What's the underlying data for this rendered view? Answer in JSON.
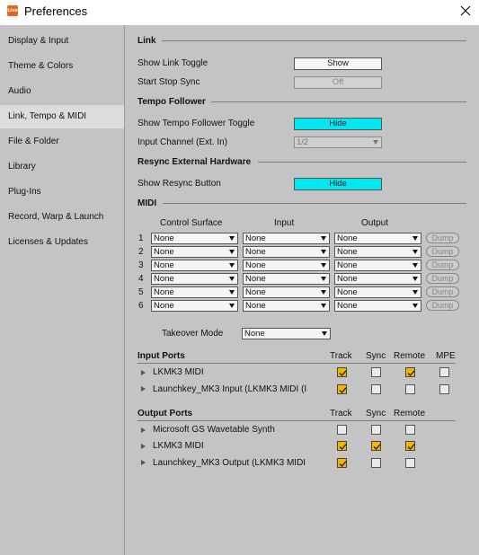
{
  "window": {
    "title": "Preferences",
    "app_icon_text": "Live"
  },
  "sidebar": {
    "items": [
      {
        "label": "Display & Input"
      },
      {
        "label": "Theme & Colors"
      },
      {
        "label": "Audio"
      },
      {
        "label": "Link, Tempo & MIDI",
        "selected": true
      },
      {
        "label": "File & Folder"
      },
      {
        "label": "Library"
      },
      {
        "label": "Plug-Ins"
      },
      {
        "label": "Record, Warp & Launch"
      },
      {
        "label": "Licenses & Updates"
      }
    ]
  },
  "link": {
    "header": "Link",
    "show_link_toggle": {
      "label": "Show Link Toggle",
      "value": "Show"
    },
    "start_stop_sync": {
      "label": "Start Stop Sync",
      "value": "Off"
    }
  },
  "tempo": {
    "header": "Tempo Follower",
    "show_toggle": {
      "label": "Show Tempo Follower Toggle",
      "value": "Hide"
    },
    "input_channel": {
      "label": "Input Channel (Ext. In)",
      "value": "1/2"
    }
  },
  "resync": {
    "header": "Resync External Hardware",
    "show_button": {
      "label": "Show Resync Button",
      "value": "Hide"
    }
  },
  "midi": {
    "header": "MIDI",
    "columns": {
      "control_surface": "Control Surface",
      "input": "Input",
      "output": "Output"
    },
    "rows": [
      {
        "num": "1",
        "surface": "None",
        "input": "None",
        "output": "None",
        "dump": "Dump"
      },
      {
        "num": "2",
        "surface": "None",
        "input": "None",
        "output": "None",
        "dump": "Dump"
      },
      {
        "num": "3",
        "surface": "None",
        "input": "None",
        "output": "None",
        "dump": "Dump"
      },
      {
        "num": "4",
        "surface": "None",
        "input": "None",
        "output": "None",
        "dump": "Dump"
      },
      {
        "num": "5",
        "surface": "None",
        "input": "None",
        "output": "None",
        "dump": "Dump"
      },
      {
        "num": "6",
        "surface": "None",
        "input": "None",
        "output": "None",
        "dump": "Dump"
      }
    ],
    "takeover": {
      "label": "Takeover Mode",
      "value": "None"
    }
  },
  "input_ports": {
    "header": "Input Ports",
    "columns": {
      "track": "Track",
      "sync": "Sync",
      "remote": "Remote",
      "mpe": "MPE"
    },
    "rows": [
      {
        "name": "LKMK3 MIDI",
        "track": true,
        "sync": false,
        "remote": true,
        "mpe": false
      },
      {
        "name": "Launchkey_MK3 Input (LKMK3 MIDI (I",
        "track": true,
        "sync": false,
        "remote": false,
        "mpe": false
      }
    ]
  },
  "output_ports": {
    "header": "Output Ports",
    "columns": {
      "track": "Track",
      "sync": "Sync",
      "remote": "Remote"
    },
    "rows": [
      {
        "name": "Microsoft GS Wavetable Synth",
        "track": false,
        "sync": false,
        "remote": false
      },
      {
        "name": "LKMK3 MIDI",
        "track": true,
        "sync": true,
        "remote": true
      },
      {
        "name": "Launchkey_MK3 Output (LKMK3 MIDI",
        "track": true,
        "sync": false,
        "remote": false
      }
    ]
  },
  "colors": {
    "active_toggle": "#00e8f2",
    "checked": "#f4b400",
    "app_icon": "#e9631f"
  }
}
